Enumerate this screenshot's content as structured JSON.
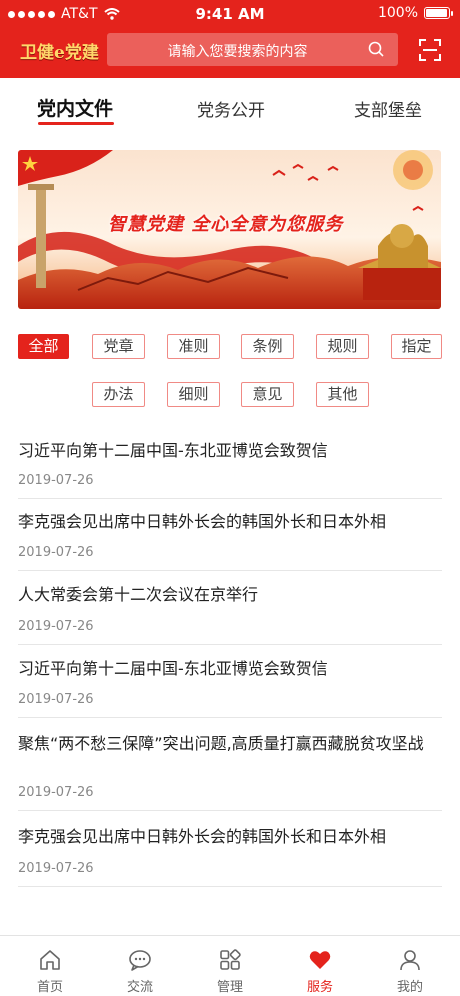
{
  "status_bar": {
    "carrier": "AT&T",
    "time": "9:41 AM",
    "battery": "100%"
  },
  "header": {
    "logo": "卫健e党建",
    "search": {
      "placeholder": "请输入您要搜索的内容"
    }
  },
  "tabs": [
    {
      "label": "党内文件",
      "active": true
    },
    {
      "label": "党务公开",
      "active": false
    },
    {
      "label": "支部堡垒",
      "active": false
    }
  ],
  "banner": {
    "slogan": "智慧党建  全心全意为您服务"
  },
  "categories": [
    {
      "label": "全部",
      "active": true
    },
    {
      "label": "党章"
    },
    {
      "label": "准则"
    },
    {
      "label": "条例"
    },
    {
      "label": "规则"
    },
    {
      "label": "指定"
    },
    {
      "label": "办法"
    },
    {
      "label": "细则"
    },
    {
      "label": "意见"
    },
    {
      "label": "其他"
    }
  ],
  "articles": [
    {
      "title": "习近平向第十二届中国-东北亚博览会致贺信",
      "date": "2019-07-26"
    },
    {
      "title": "李克强会见出席中日韩外长会的韩国外长和日本外相",
      "date": "2019-07-26"
    },
    {
      "title": "人大常委会第十二次会议在京举行",
      "date": "2019-07-26"
    },
    {
      "title": "习近平向第十二届中国-东北亚博览会致贺信",
      "date": "2019-07-26"
    },
    {
      "title": "聚焦“两不愁三保障”突出问题,高质量打赢西藏脱贫攻坚战",
      "date": "2019-07-26"
    },
    {
      "title": "李克强会见出席中日韩外长会的韩国外长和日本外相",
      "date": "2019-07-26"
    }
  ],
  "bottom_nav": [
    {
      "label": "首页",
      "icon": "home-icon"
    },
    {
      "label": "交流",
      "icon": "chat-icon"
    },
    {
      "label": "管理",
      "icon": "grid-icon"
    },
    {
      "label": "服务",
      "icon": "heart-icon",
      "active": true
    },
    {
      "label": "我的",
      "icon": "user-icon"
    }
  ],
  "colors": {
    "primary": "#e4231c",
    "chip_border": "#f08a85",
    "muted": "#888888"
  }
}
